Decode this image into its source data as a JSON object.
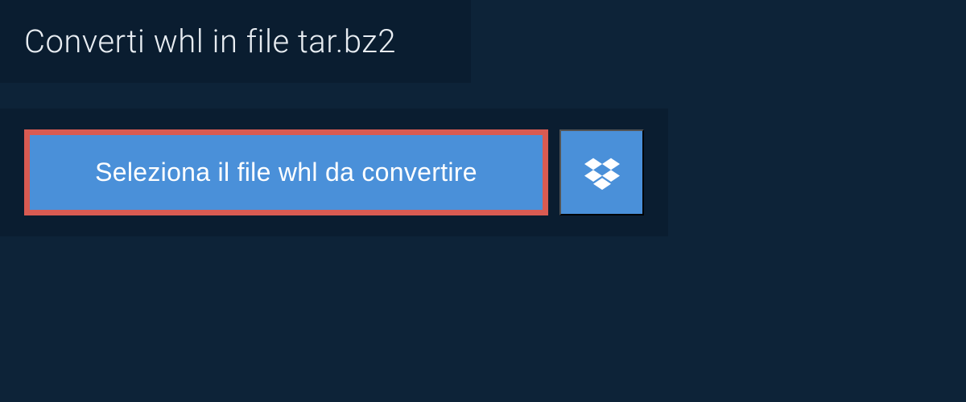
{
  "header": {
    "title": "Converti whl in file tar.bz2"
  },
  "upload": {
    "select_label": "Seleziona il file whl da convertire"
  },
  "colors": {
    "background": "#0d2338",
    "panel": "#0a1d30",
    "button_bg": "#4a90d9",
    "highlight_border": "#d95b52",
    "text_light": "#e8edf2",
    "text_white": "#ffffff"
  }
}
